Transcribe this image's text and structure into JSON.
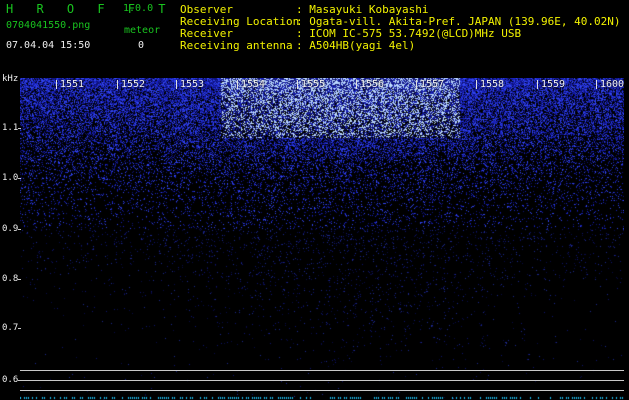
{
  "app": {
    "name": "H R O F F T",
    "version": "1.0.0"
  },
  "file": {
    "name": "0704041550.png",
    "datetime": "07.04.04 15:50"
  },
  "meteor": {
    "label": "meteor",
    "count": "0"
  },
  "info": {
    "observer_label": "Observer",
    "observer_value": ": Masayuki Kobayashi",
    "location_label": "Receiving Location",
    "location_value": ": Ogata-vill. Akita-Pref. JAPAN (139.96E, 40.02N)",
    "receiver_label": "Receiver",
    "receiver_value": ": ICOM IC-575 53.7492(@LCD)MHz USB",
    "antenna_label": "Receiving antenna",
    "antenna_value": ": A504HB(yagi 4el)"
  },
  "axis": {
    "unit": "kHz",
    "y_ticks": [
      "1.1",
      "1.0",
      "0.9",
      "0.8",
      "0.7",
      "0.6"
    ],
    "x_ticks": [
      "1551",
      "1552",
      "1553",
      "1554",
      "1555",
      "1556",
      "1557",
      "1558",
      "1559",
      "1600"
    ]
  },
  "colors": {
    "text_green": "#19c41f",
    "text_yellow": "#f2f200",
    "text_white": "#f0f0f0",
    "noise_blue": "#2a3cff",
    "background": "#000000"
  }
}
